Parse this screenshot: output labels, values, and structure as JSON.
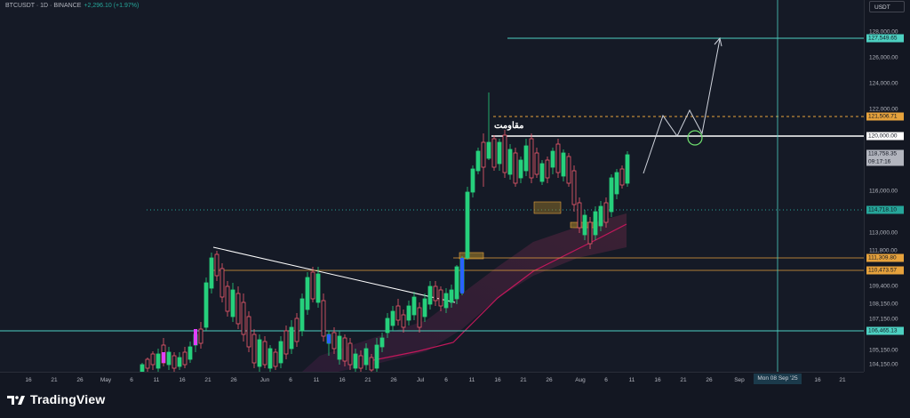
{
  "header": {
    "symbol": "BTCUSDT · 1D · BINANCE",
    "change": "+2,296.10 (+1.97%)"
  },
  "currency_button": "USDT",
  "annotation": {
    "resistance_text": "مقاومت"
  },
  "price_axis": {
    "labels": [
      "128,000.00",
      "126,000.00",
      "124,000.00",
      "122,000.00",
      "118,000.00",
      "116,000.00",
      "113,000.00",
      "111,800.00",
      "109,400.00",
      "108,150.00",
      "107,150.00",
      "105,150.00",
      "104,150.00"
    ],
    "tags": {
      "target": "127,549.65",
      "upper": "121,506.71",
      "resistance": "120,000.00",
      "current": "118,758.35",
      "countdown": "09:17:16",
      "support1": "114,718.10",
      "support2": "111,309.80",
      "support3": "110,473.57",
      "support4": "106,465.13"
    }
  },
  "time_axis": {
    "labels": [
      "16",
      "21",
      "26",
      "May",
      "6",
      "11",
      "16",
      "21",
      "26",
      "Jun",
      "6",
      "11",
      "16",
      "21",
      "26",
      "Jul",
      "6",
      "11",
      "16",
      "21",
      "26",
      "Aug",
      "6",
      "11",
      "16",
      "21",
      "26",
      "Sep",
      "16",
      "21"
    ],
    "crosshair_date": "Mon 08 Sep '25"
  },
  "colors": {
    "up": "#26d07c",
    "down": "#f05b6e",
    "teal": "#4dd0c1",
    "orange": "#e6a23c",
    "accent_blue": "#2962ff"
  },
  "footer": {
    "brand": "TradingView"
  }
}
